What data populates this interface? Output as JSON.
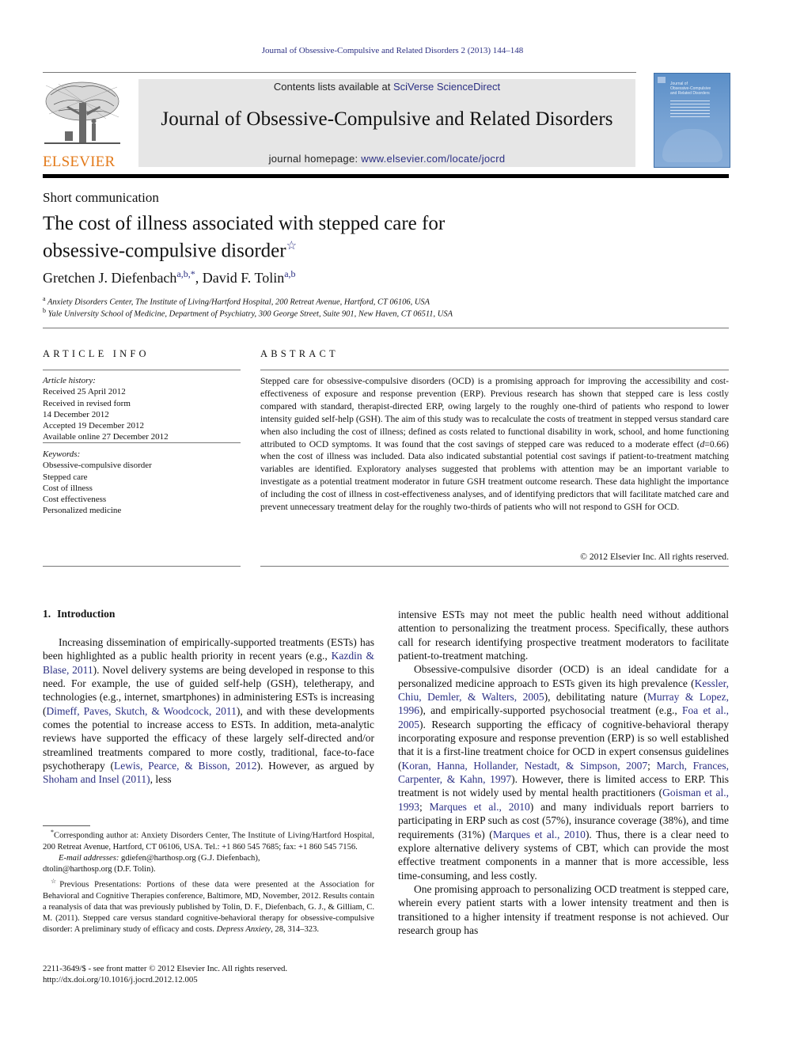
{
  "running_head": "Journal of Obsessive-Compulsive and Related Disorders 2 (2013) 144–148",
  "publisher": {
    "logo_text": "ELSEVIER",
    "logo_color": "#e37a1a",
    "link_color": "#2b2f83"
  },
  "banner": {
    "contents_prefix": "Contents lists available at ",
    "contents_link": "SciVerse ScienceDirect",
    "journal_title": "Journal of Obsessive-Compulsive and Related Disorders",
    "homepage_prefix": "journal homepage: ",
    "homepage_link": "www.elsevier.com/locate/jocrd"
  },
  "cover": {
    "title_line1": "Journal of",
    "title_line2": "Obsessive-Compulsive",
    "title_line3": "and Related Disorders"
  },
  "article": {
    "type": "Short communication",
    "title_line1": "The cost of illness associated with stepped care for",
    "title_line2": "obsessive-compulsive disorder",
    "title_mark": "☆",
    "authors": [
      {
        "name": "Gretchen J. Diefenbach",
        "marks": "a,b,*"
      },
      {
        "name": "David F. Tolin",
        "marks": "a,b"
      }
    ],
    "author_separator": ", ",
    "affiliations": [
      {
        "mark": "a",
        "text": "Anxiety Disorders Center, The Institute of Living/Hartford Hospital, 200 Retreat Avenue, Hartford, CT 06106, USA"
      },
      {
        "mark": "b",
        "text": "Yale University School of Medicine, Department of Psychiatry, 300 George Street, Suite 901, New Haven, CT 06511, USA"
      }
    ]
  },
  "article_info": {
    "heading": "ARTICLE INFO",
    "history_label": "Article history:",
    "history": [
      "Received 25 April 2012",
      "Received in revised form",
      "14 December 2012",
      "Accepted 19 December 2012",
      "Available online 27 December 2012"
    ],
    "keywords_label": "Keywords:",
    "keywords": [
      "Obsessive-compulsive disorder",
      "Stepped care",
      "Cost of illness",
      "Cost effectiveness",
      "Personalized medicine"
    ]
  },
  "abstract": {
    "heading": "ABSTRACT",
    "text_part1": "Stepped care for obsessive-compulsive disorders (OCD) is a promising approach for improving the accessibility and cost-effectiveness of exposure and response prevention (ERP). Previous research has shown that stepped care is less costly compared with standard, therapist-directed ERP, owing largely to the roughly one-third of patients who respond to lower intensity guided self-help (GSH). The aim of this study was to recalculate the costs of treatment in stepped versus standard care when also including the cost of illness; defined as costs related to functional disability in work, school, and home functioning attributed to OCD symptoms. It was found that the cost savings of stepped care was reduced to a moderate effect (",
    "effect_var": "d",
    "effect_value": "=0.66",
    "text_part2": ") when the cost of illness was included. Data also indicated substantial potential cost savings if patient-to-treatment matching variables are identified. Exploratory analyses suggested that problems with attention may be an important variable to investigate as a potential treatment moderator in future GSH treatment outcome research. These data highlight the importance of including the cost of illness in cost-effectiveness analyses, and of identifying predictors that will facilitate matched care and prevent unnecessary treatment delay for the roughly two-thirds of patients who will not respond to GSH for OCD.",
    "copyright": "© 2012 Elsevier Inc. All rights reserved."
  },
  "section1": {
    "number": "1.",
    "title": "Introduction",
    "left_p1": {
      "t1": "Increasing dissemination of empirically-supported treatments (ESTs) has been highlighted as a public health priority in recent years (e.g., ",
      "c1": "Kazdin & Blase, 2011",
      "t2": "). Novel delivery systems are being developed in response to this need. For example, the use of guided self-help (GSH), teletherapy, and technologies (e.g., internet, smartphones) in administering ESTs is increasing (",
      "c2": "Dimeff, Paves, Skutch, & Woodcock, 2011",
      "t3": "), and with these developments comes the potential to increase access to ESTs. In addition, meta-analytic reviews have supported the efficacy of these largely self-directed and/or streamlined treatments compared to more costly, traditional, face-to-face psychotherapy (",
      "c3": "Lewis, Pearce, & Bisson, 2012",
      "t4": "). However, as argued by ",
      "c4": "Shoham and Insel (2011)",
      "t5": ", less"
    },
    "right_p0": "intensive ESTs may not meet the public health need without additional attention to personalizing the treatment process. Specifically, these authors call for research identifying prospective treatment moderators to facilitate patient-to-treatment matching.",
    "right_p1": {
      "t1": "Obsessive-compulsive disorder (OCD) is an ideal candidate for a personalized medicine approach to ESTs given its high prevalence (",
      "c1": "Kessler, Chiu, Demler, & Walters, 2005",
      "t2": "), debilitating nature (",
      "c2": "Murray & Lopez, 1996",
      "t3": "), and empirically-supported psychosocial treatment (e.g., ",
      "c3": "Foa et al., 2005",
      "t4": "). Research supporting the efficacy of cognitive-behavioral therapy incorporating exposure and response prevention (ERP) is so well established that it is a first-line treatment choice for OCD in expert consensus guidelines (",
      "c4": "Koran, Hanna, Hollander, Nestadt, & Simpson, 2007",
      "t5": "; ",
      "c5": "March, Frances, Carpenter, & Kahn, 1997",
      "t6": "). However, there is limited access to ERP. This treatment is not widely used by mental health practitioners (",
      "c6": "Goisman et al., 1993",
      "t7": "; ",
      "c7": "Marques et al., 2010",
      "t8": ") and many individuals report barriers to participating in ERP such as cost (57%), insurance coverage (38%), and time requirements (31%) (",
      "c8": "Marques et al., 2010",
      "t9": "). Thus, there is a clear need to explore alternative delivery systems of CBT, which can provide the most effective treatment components in a manner that is more accessible, less time-consuming, and less costly."
    },
    "right_p2": "One promising approach to personalizing OCD treatment is stepped care, wherein every patient starts with a lower intensity treatment and then is transitioned to a higher intensity if treatment response is not achieved. Our research group has"
  },
  "footnotes": {
    "corresponding_mark": "*",
    "corresponding": "Corresponding author at: Anxiety Disorders Center, The Institute of Living/Hartford Hospital, 200 Retreat Avenue, Hartford, CT 06106, USA. Tel.: +1 860 545 7685; fax: +1 860 545 7156.",
    "email_label": "E-mail addresses:",
    "email1": " gdiefen@harthosp.org (G.J. Diefenbach),",
    "email2": "dtolin@harthosp.org (D.F. Tolin).",
    "presentation_mark": "☆",
    "presentation_text": "Previous Presentations: Portions of these data were presented at the Association for Behavioral and Cognitive Therapies conference, Baltimore, MD, November, 2012. Results contain a reanalysis of data that was previously published by Tolin, D. F., Diefenbach, G. J., & Gilliam, C. M. (2011). Stepped care versus standard cognitive-behavioral therapy for obsessive-compulsive disorder: A preliminary study of efficacy and costs. ",
    "presentation_journal": "Depress Anxiety",
    "presentation_tail": ", 28, 314–323."
  },
  "issn_line": "2211-3649/$ - see front matter © 2012 Elsevier Inc. All rights reserved.",
  "doi_line": "http://dx.doi.org/10.1016/j.jocrd.2012.12.005"
}
